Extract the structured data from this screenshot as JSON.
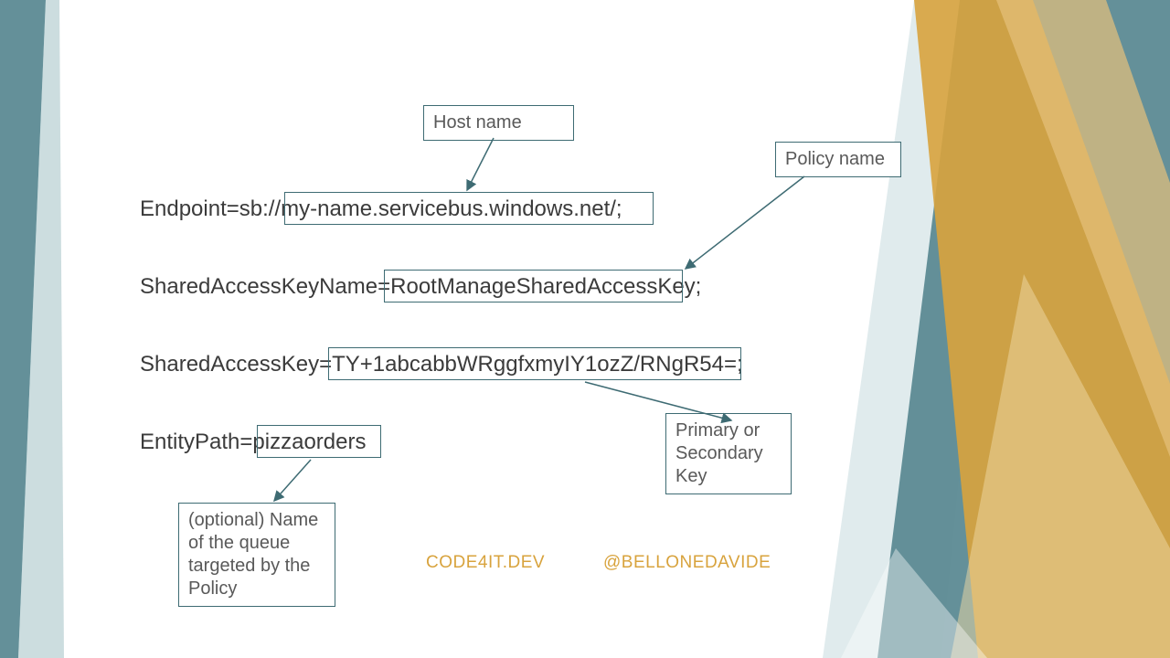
{
  "lines": {
    "line1_prefix": "Endpoint=sb://",
    "line1_host": "my-name.servicebus.windows.net/;",
    "line2_prefix": "SharedAccessKeyName=",
    "line2_value": "RootManageSharedAccessKey;",
    "line3_prefix": "SharedAccessKey=",
    "line3_value": "TY+1abcabbWRggfxmyIY1ozZ/RNgR54=;",
    "line4_prefix": "EntityPath=",
    "line4_value": "pizzaorders"
  },
  "labels": {
    "hostname": "Host name",
    "policyname": "Policy name",
    "keylabel": "Primary or Secondary Key",
    "entitylabel": "(optional) Name of the queue targeted by the Policy"
  },
  "footer": {
    "site": "CODE4IT.DEV",
    "handle": "@BELLONEDAVIDE"
  }
}
